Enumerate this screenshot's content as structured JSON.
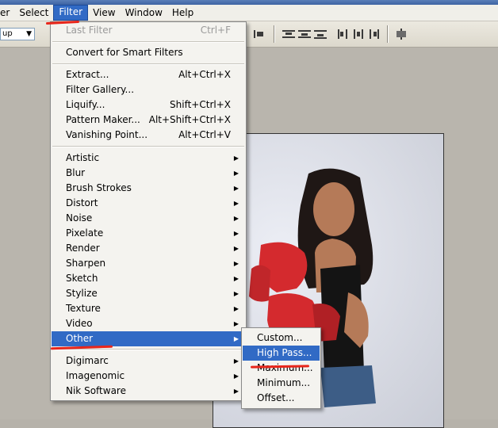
{
  "menubar": [
    "er",
    "Select",
    "Filter",
    "View",
    "Window",
    "Help"
  ],
  "options": {
    "preset_value": "up"
  },
  "filter_menu": {
    "last_filter": {
      "label": "Last Filter",
      "shortcut": "Ctrl+F"
    },
    "smart": "Convert for Smart Filters",
    "group1": [
      {
        "label": "Extract...",
        "shortcut": "Alt+Ctrl+X"
      },
      {
        "label": "Filter Gallery...",
        "shortcut": ""
      },
      {
        "label": "Liquify...",
        "shortcut": "Shift+Ctrl+X"
      },
      {
        "label": "Pattern Maker...",
        "shortcut": "Alt+Shift+Ctrl+X"
      },
      {
        "label": "Vanishing Point...",
        "shortcut": "Alt+Ctrl+V"
      }
    ],
    "group2": [
      "Artistic",
      "Blur",
      "Brush Strokes",
      "Distort",
      "Noise",
      "Pixelate",
      "Render",
      "Sharpen",
      "Sketch",
      "Stylize",
      "Texture",
      "Video",
      "Other"
    ],
    "group3": [
      "Digimarc",
      "Imagenomic",
      "Nik Software"
    ]
  },
  "other_submenu": [
    "Custom...",
    "High Pass...",
    "Maximum...",
    "Minimum...",
    "Offset..."
  ],
  "colors": {
    "highlight": "#316ac5",
    "annotation": "#e8261b"
  }
}
